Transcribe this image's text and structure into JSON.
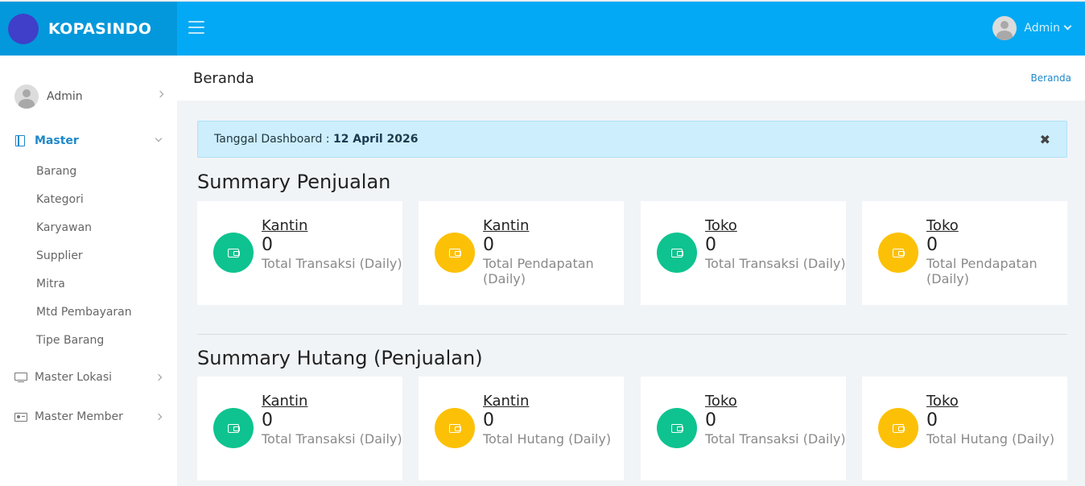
{
  "brand": {
    "name": "KOPASINDO"
  },
  "topbar": {
    "user_name": "Admin",
    "user_caret": "⌄"
  },
  "sidebar": {
    "user_name": "Admin",
    "master": {
      "label": "Master",
      "children": [
        "Barang",
        "Kategori",
        "Karyawan",
        "Supplier",
        "Mitra",
        "Mtd Pembayaran",
        "Tipe Barang"
      ]
    },
    "master_lokasi": "Master Lokasi",
    "master_member": "Master Member"
  },
  "header": {
    "title": "Beranda",
    "breadcrumb": "Beranda"
  },
  "alert": {
    "prefix": "Tanggal Dashboard : ",
    "date": "12 April 2026",
    "close": "✖"
  },
  "penjualan": {
    "title": "Summary Penjualan",
    "cards": [
      {
        "link": "Kantin",
        "value": "0",
        "label": "Total Transaksi (Daily)",
        "color": "green"
      },
      {
        "link": "Kantin",
        "value": "0",
        "label": "Total Pendapatan (Daily)",
        "color": "yellow"
      },
      {
        "link": "Toko",
        "value": "0",
        "label": "Total Transaksi (Daily)",
        "color": "green"
      },
      {
        "link": "Toko",
        "value": "0",
        "label": "Total Pendapatan (Daily)",
        "color": "yellow"
      }
    ]
  },
  "hutang": {
    "title": "Summary Hutang (Penjualan)",
    "cards": [
      {
        "link": "Kantin",
        "value": "0",
        "label": "Total Transaksi (Daily)",
        "color": "green"
      },
      {
        "link": "Kantin",
        "value": "0",
        "label": "Total Hutang (Daily)",
        "color": "yellow"
      },
      {
        "link": "Toko",
        "value": "0",
        "label": "Total Transaksi (Daily)",
        "color": "green"
      },
      {
        "link": "Toko",
        "value": "0",
        "label": "Total Hutang (Daily)",
        "color": "yellow"
      }
    ]
  },
  "colors": {
    "topbar": "#03a9f4",
    "brand_bg": "#0398db",
    "green": "#0ec38f",
    "yellow": "#fcc106",
    "accent": "#1e88c8"
  },
  "icons": {
    "menu": "hamburger-icon",
    "master": "book-icon",
    "master_lokasi": "monitor-icon",
    "master_member": "id-card-icon",
    "card": "wallet-icon"
  }
}
